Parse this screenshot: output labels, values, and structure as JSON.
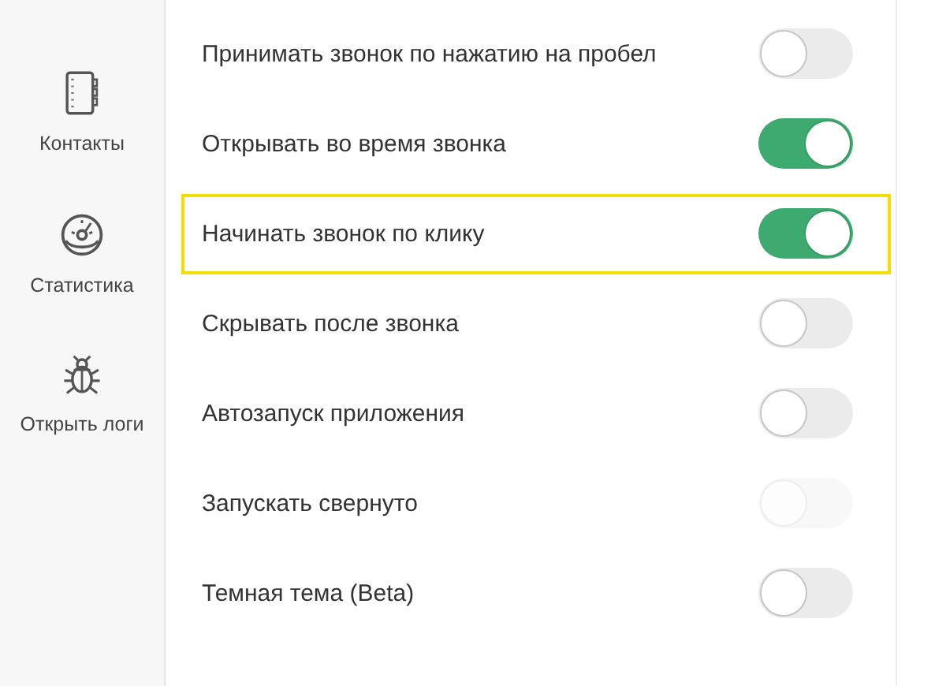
{
  "sidebar": {
    "items": [
      {
        "label": "Контакты",
        "kind": "contacts"
      },
      {
        "label": "Статистика",
        "kind": "stats"
      },
      {
        "label": "Открыть логи",
        "kind": "logs"
      }
    ]
  },
  "settings": [
    {
      "label": "Принимать звонок по нажатию на пробел",
      "on": false,
      "disabled": false,
      "highlighted": false
    },
    {
      "label": "Открывать во время звонка",
      "on": true,
      "disabled": false,
      "highlighted": false
    },
    {
      "label": "Начинать звонок по клику",
      "on": true,
      "disabled": false,
      "highlighted": true
    },
    {
      "label": "Скрывать после звонка",
      "on": false,
      "disabled": false,
      "highlighted": false
    },
    {
      "label": "Автозапуск приложения",
      "on": false,
      "disabled": false,
      "highlighted": false
    },
    {
      "label": "Запускать свернуто",
      "on": false,
      "disabled": true,
      "highlighted": false
    },
    {
      "label": "Темная тема (Beta)",
      "on": false,
      "disabled": false,
      "highlighted": false
    }
  ]
}
